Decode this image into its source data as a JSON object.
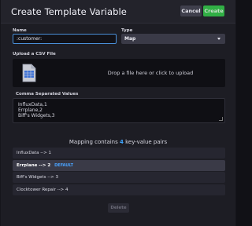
{
  "dialog": {
    "title": "Create Template Variable",
    "cancel_label": "Cancel",
    "create_label": "Create"
  },
  "form": {
    "name_label": "Name",
    "name_value": ":customer:",
    "type_label": "Type",
    "type_value": "Map"
  },
  "upload": {
    "label": "Upload a CSV File",
    "drop_text": "Drop a file here or click to upload",
    "icon": "csv-file-icon"
  },
  "csv": {
    "label": "Comma Separated Values",
    "lines": [
      "InfluxData,1",
      "Errplane,2",
      "Biff's Widgets,3"
    ]
  },
  "mapping": {
    "prefix": "Mapping contains",
    "count": "4",
    "suffix": "key-value pairs",
    "pairs": [
      {
        "text": "InfluxData --> 1",
        "badge": ""
      },
      {
        "text": "Errplane --> 2",
        "badge": "DEFAULT"
      },
      {
        "text": "Biff's Widgets --> 3",
        "badge": ""
      },
      {
        "text": "Clocktower Repair --> 4",
        "badge": ""
      }
    ]
  },
  "delete_label": "Delete",
  "colors": {
    "accent_blue": "#4a8fd8",
    "create_green": "#34c84a",
    "count_blue": "#3ea6ff"
  }
}
